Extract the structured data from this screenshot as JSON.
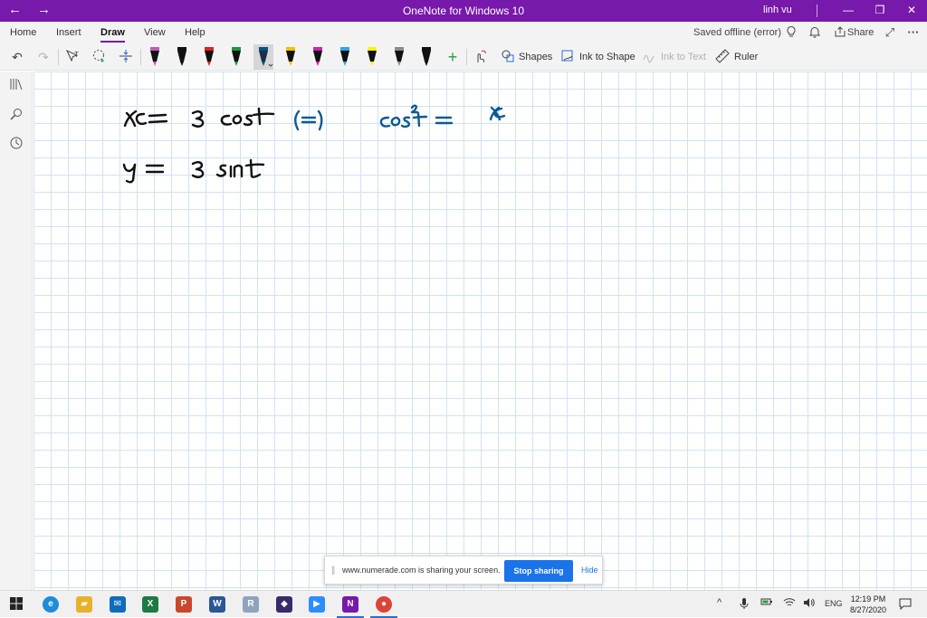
{
  "titlebar": {
    "title": "OneNote for Windows 10",
    "user": "linh vu",
    "back_icon": "←",
    "forward_icon": "→",
    "minimize_icon": "—",
    "maximize_icon": "❐",
    "close_icon": "✕",
    "accent": "#7719aa"
  },
  "ribbon": {
    "tabs": [
      {
        "label": "Home"
      },
      {
        "label": "Insert"
      },
      {
        "label": "Draw"
      },
      {
        "label": "View"
      },
      {
        "label": "Help"
      }
    ],
    "active_tab": "Draw",
    "sync_status": "Saved offline (error)",
    "share_label": "Share",
    "more_icon": "···",
    "lightbulb_icon": "💡",
    "bell_icon": "🔔",
    "expand_icon": "⤢"
  },
  "toolbar": {
    "pens": [
      {
        "name": "pen-black-pink-highlight",
        "color": "#111111",
        "tip": "#c25bb8"
      },
      {
        "name": "pen-black",
        "color": "#111111",
        "tip": "#111111"
      },
      {
        "name": "pen-red",
        "color": "#111111",
        "tip": "#e02020"
      },
      {
        "name": "pen-green",
        "color": "#111111",
        "tip": "#1a9a3a"
      },
      {
        "name": "pen-navy-selected",
        "color": "#1b2f4a",
        "tip": "#0d4f86"
      },
      {
        "name": "pen-yellow",
        "color": "#111111",
        "tip": "#f2c100"
      },
      {
        "name": "pen-magenta",
        "color": "#111111",
        "tip": "#d01ec0"
      },
      {
        "name": "pen-cyan",
        "color": "#111111",
        "tip": "#2aa8e6"
      },
      {
        "name": "highlighter-yellow",
        "color": "#111111",
        "tip": "#fff200"
      },
      {
        "name": "pencil-gray",
        "color": "#111111",
        "tip": "#8a8a8a"
      },
      {
        "name": "pen-black-2",
        "color": "#111111",
        "tip": "#111111"
      }
    ],
    "add_pen_icon": "+",
    "shapes_label": "Shapes",
    "ink_to_shape_label": "Ink to Shape",
    "ink_to_text_label": "Ink to Text",
    "ruler_label": "Ruler"
  },
  "canvas": {
    "ink_color_black": "#111111",
    "ink_color_blue": "#0d5a91",
    "grid_color": "#cfe3f2"
  },
  "share_banner": {
    "message": "www.numerade.com is sharing your screen.",
    "stop_label": "Stop sharing",
    "hide_label": "Hide"
  },
  "taskbar": {
    "apps": [
      {
        "name": "edge",
        "glyph": "e",
        "color": "#1f8cd8"
      },
      {
        "name": "file-explorer",
        "glyph": "▰",
        "color": "#e8b12b"
      },
      {
        "name": "mail",
        "glyph": "✉",
        "color": "#0f6cbd"
      },
      {
        "name": "excel",
        "glyph": "X",
        "color": "#1d7a43"
      },
      {
        "name": "powerpoint",
        "glyph": "P",
        "color": "#c9472c"
      },
      {
        "name": "word",
        "glyph": "W",
        "color": "#2b5797"
      },
      {
        "name": "r",
        "glyph": "R",
        "color": "#8fa3bf"
      },
      {
        "name": "photo-app",
        "glyph": "◆",
        "color": "#3a2a6b"
      },
      {
        "name": "zoom",
        "glyph": "▶",
        "color": "#2d8cff"
      },
      {
        "name": "onenote",
        "glyph": "N",
        "color": "#7719aa"
      },
      {
        "name": "chrome",
        "glyph": "●",
        "color": "#db4437"
      }
    ],
    "language": "ENG",
    "time": "12:19 PM",
    "date": "8/27/2020"
  }
}
